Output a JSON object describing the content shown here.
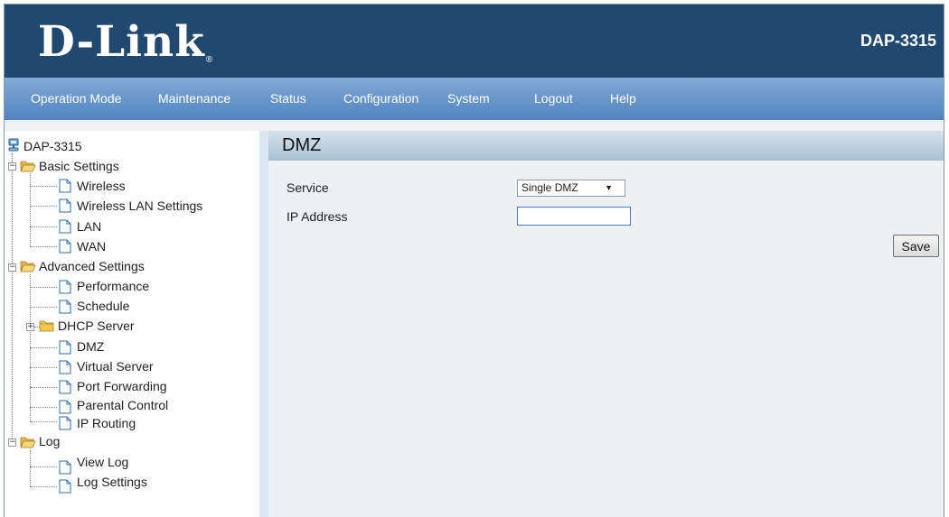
{
  "brand": {
    "logo_text": "D-Link",
    "registered_mark": "®",
    "model": "DAP-3315"
  },
  "nav": [
    {
      "label": "Operation Mode"
    },
    {
      "label": "Maintenance"
    },
    {
      "label": "Status"
    },
    {
      "label": "Configuration"
    },
    {
      "label": "System"
    },
    {
      "label": "Logout"
    },
    {
      "label": "Help"
    }
  ],
  "tree": {
    "root": "DAP-3315",
    "basic": {
      "label": "Basic Settings",
      "items": [
        "Wireless",
        "Wireless LAN Settings",
        "LAN",
        "WAN"
      ]
    },
    "advanced": {
      "label": "Advanced Settings",
      "items": [
        "Performance",
        "Schedule",
        "DHCP Server",
        "DMZ",
        "Virtual Server",
        "Port Forwarding",
        "Parental Control",
        "IP Routing"
      ]
    },
    "log": {
      "label": "Log",
      "items": [
        "View Log",
        "Log Settings"
      ]
    }
  },
  "page": {
    "title": "DMZ",
    "service_label": "Service",
    "service_value": "Single DMZ",
    "service_arrow": "▼",
    "ip_label": "IP Address",
    "ip_value": "",
    "save_label": "Save"
  },
  "colors": {
    "header": "#21486f",
    "nav_top": "#84abd6",
    "nav_bottom": "#4f83bf",
    "content_bg": "#edf1f4",
    "folder": "#f2c94c"
  }
}
